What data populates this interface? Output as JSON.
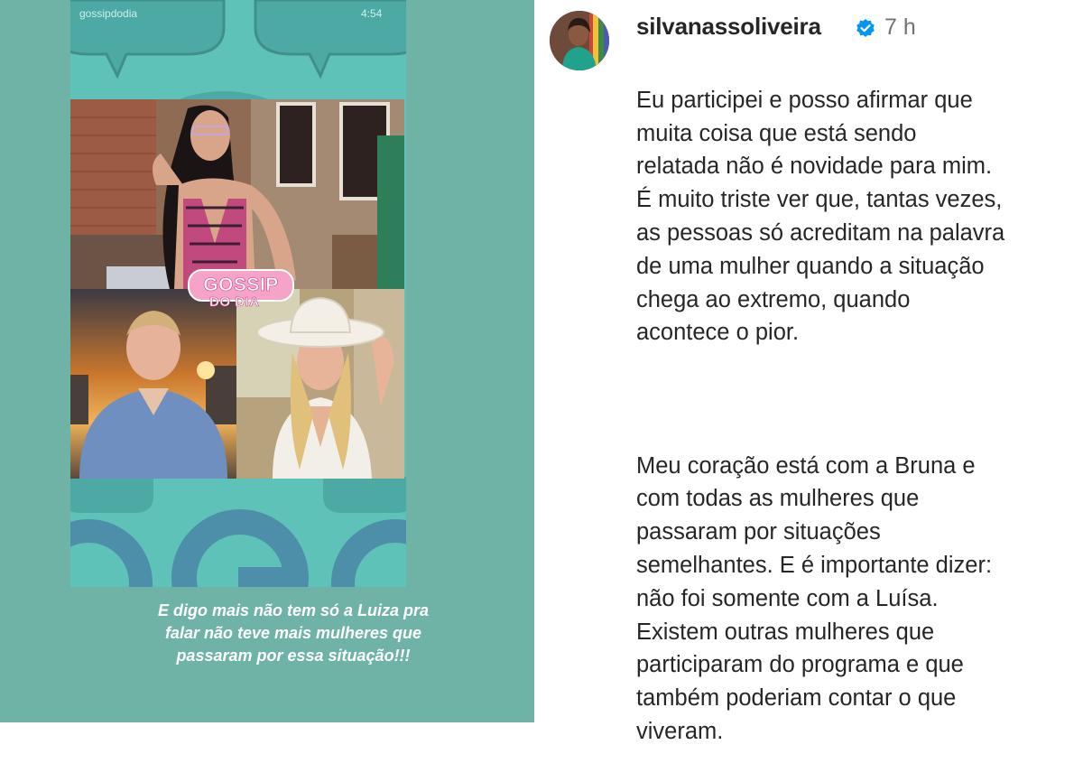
{
  "story": {
    "username": "gossipdodia",
    "time": "4:54",
    "logo_text": "GOSSIP",
    "logo_subtext": "DO DIA",
    "caption": "E digo mais não tem só a Luiza pra falar não teve mais mulheres que passaram por essa situação!!!"
  },
  "comment": {
    "username": "silvanassoliveira",
    "verified": true,
    "time": "7 h",
    "paragraph1": "Eu participei e posso afirmar que\nmuita coisa que está sendo\nrelatada não é novidade para mim.\nÉ muito triste ver que, tantas vezes,\nas pessoas só acreditam na palavra\nde uma mulher quando a situação\nchega ao extremo, quando\nacontece o pior.",
    "paragraph2": "Meu coração está com a Bruna e\ncom todas as mulheres que\npassaram por situações\nsemelhantes. E é importante dizer:\nnão foi somente com a Luísa.\nExistem outras mulheres que\nparticiparam do programa e que\ntambém poderiam contar o que\nviveram."
  },
  "colors": {
    "story_bg": "#6fb3a6",
    "story_card": "#5fc2b9",
    "logo_pink": "#f5a3c7",
    "verified_blue": "#0095f6"
  }
}
